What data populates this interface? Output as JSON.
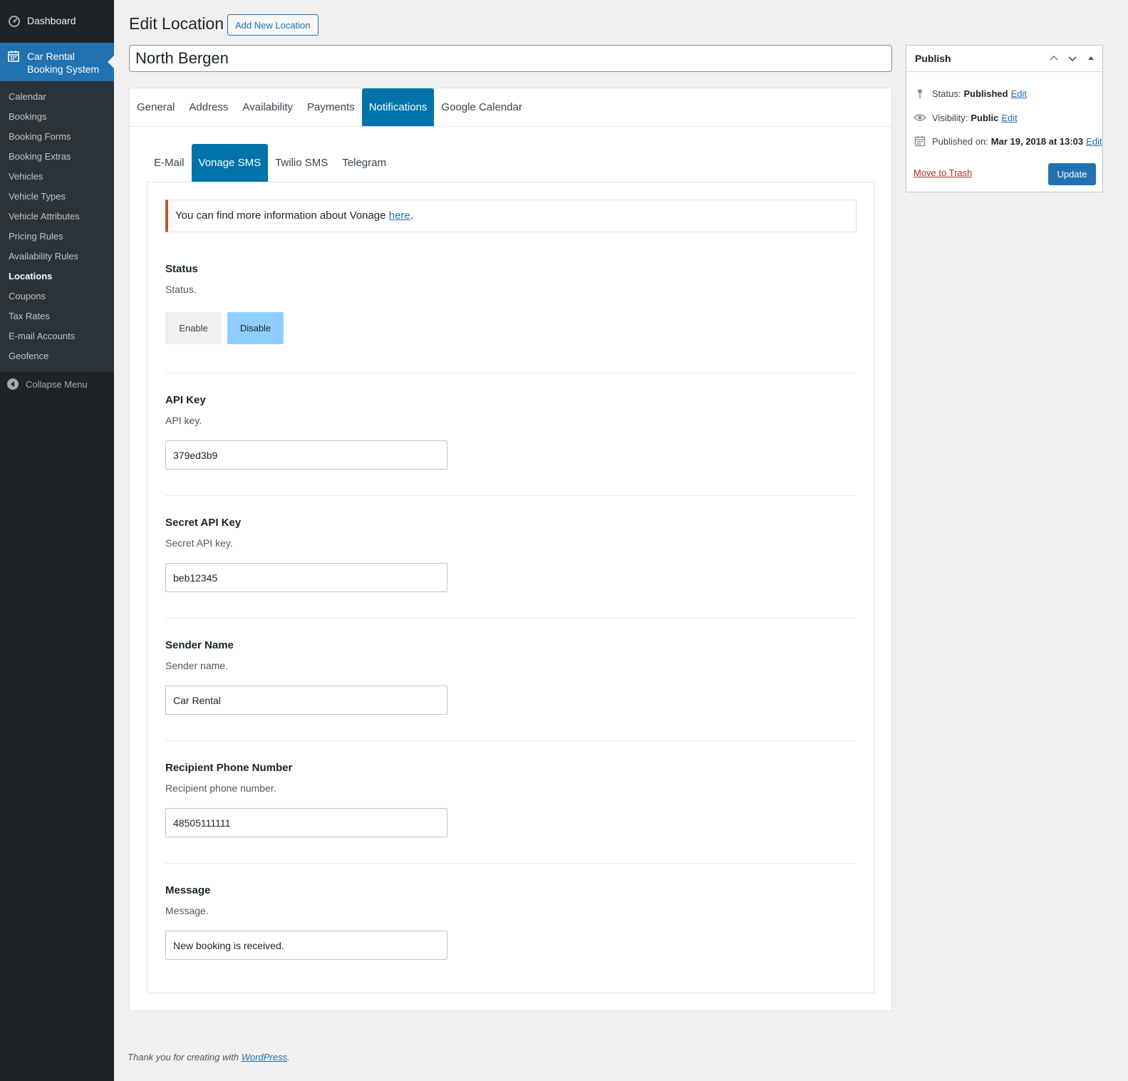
{
  "sidebar": {
    "dashboard_label": "Dashboard",
    "active_menu_line1": "Car Rental",
    "active_menu_line2": "Booking System",
    "submenu": [
      {
        "label": "Calendar"
      },
      {
        "label": "Bookings"
      },
      {
        "label": "Booking Forms"
      },
      {
        "label": "Booking Extras"
      },
      {
        "label": "Vehicles"
      },
      {
        "label": "Vehicle Types"
      },
      {
        "label": "Vehicle Attributes"
      },
      {
        "label": "Pricing Rules"
      },
      {
        "label": "Availability Rules"
      },
      {
        "label": "Locations"
      },
      {
        "label": "Coupons"
      },
      {
        "label": "Tax Rates"
      },
      {
        "label": "E-mail Accounts"
      },
      {
        "label": "Geofence"
      }
    ],
    "collapse_label": "Collapse Menu"
  },
  "header": {
    "title": "Edit Location",
    "add_new_label": "Add New Location",
    "post_title": "North Bergen"
  },
  "tabs": [
    {
      "label": "General"
    },
    {
      "label": "Address"
    },
    {
      "label": "Availability"
    },
    {
      "label": "Payments"
    },
    {
      "label": "Notifications"
    },
    {
      "label": "Google Calendar"
    }
  ],
  "subtabs": [
    {
      "label": "E-Mail"
    },
    {
      "label": "Vonage SMS"
    },
    {
      "label": "Twilio SMS"
    },
    {
      "label": "Telegram"
    }
  ],
  "notice": {
    "text": "You can find more information about Vonage ",
    "link": "here",
    "suffix": "."
  },
  "status": {
    "label": "Status",
    "description": "Status.",
    "enable_label": "Enable",
    "disable_label": "Disable",
    "selected": "Disable"
  },
  "fields": [
    {
      "label": "API Key",
      "description": "API key.",
      "value": "379ed3b9"
    },
    {
      "label": "Secret API Key",
      "description": "Secret API key.",
      "value": "beb12345"
    },
    {
      "label": "Sender Name",
      "description": "Sender name.",
      "value": "Car Rental"
    },
    {
      "label": "Recipient Phone Number",
      "description": "Recipient phone number.",
      "value": "48505111111"
    },
    {
      "label": "Message",
      "description": "Message.",
      "value": "New booking is received."
    }
  ],
  "publish": {
    "title": "Publish",
    "status_label": "Status:",
    "status_value": "Published",
    "visibility_label": "Visibility:",
    "visibility_value": "Public",
    "published_label": "Published on:",
    "published_value": "Mar 19, 2018 at 13:03",
    "edit_label": "Edit",
    "trash_label": "Move to Trash",
    "update_label": "Update"
  },
  "footer": {
    "text": "Thank you for creating with ",
    "link": "WordPress",
    "suffix": "."
  },
  "colors": {
    "sidebar_bg": "#1d2327",
    "accent": "#2271b1",
    "tab_active": "#0073aa",
    "notice_border": "#c4532a",
    "disable_selected": "#8ecfff"
  }
}
